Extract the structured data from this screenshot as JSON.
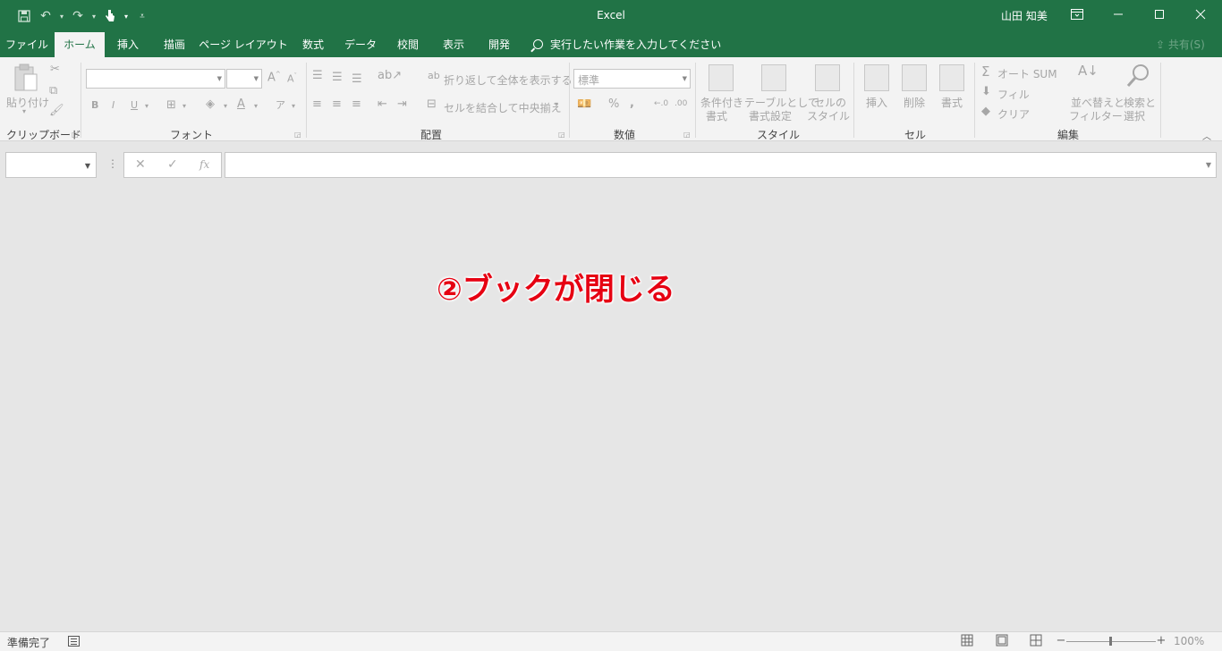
{
  "title_bar": {
    "app_title": "Excel",
    "user_name": "山田 知美"
  },
  "tabs": [
    {
      "label": "ファイル",
      "active": false
    },
    {
      "label": "ホーム",
      "active": true
    },
    {
      "label": "挿入",
      "active": false
    },
    {
      "label": "描画",
      "active": false
    },
    {
      "label": "ページ レイアウト",
      "active": false
    },
    {
      "label": "数式",
      "active": false
    },
    {
      "label": "データ",
      "active": false
    },
    {
      "label": "校閲",
      "active": false
    },
    {
      "label": "表示",
      "active": false
    },
    {
      "label": "開発",
      "active": false
    }
  ],
  "tell_me": "実行したい作業を入力してください",
  "share": "共有(S)",
  "ribbon": {
    "clipboard": {
      "group": "クリップボード",
      "paste": "貼り付け"
    },
    "font": {
      "group": "フォント"
    },
    "alignment": {
      "group": "配置",
      "wrap_text": "折り返して全体を表示する",
      "merge_center": "セルを結合して中央揃え"
    },
    "number": {
      "group": "数値",
      "format": "標準"
    },
    "styles": {
      "group": "スタイル",
      "conditional_1": "条件付き",
      "conditional_2": "書式",
      "table_1": "テーブルとして",
      "table_2": "書式設定",
      "cell_1": "セルの",
      "cell_2": "スタイル"
    },
    "cells": {
      "group": "セル",
      "insert": "挿入",
      "delete": "削除",
      "format": "書式"
    },
    "editing": {
      "group": "編集",
      "autosum": "オート SUM",
      "fill": "フィル",
      "clear": "クリア",
      "sort_1": "並べ替えと",
      "sort_2": "フィルター",
      "find_1": "検索と",
      "find_2": "選択"
    }
  },
  "formula_bar": {
    "cancel_icon": "✕",
    "enter_icon": "✓",
    "fx_label": "fx"
  },
  "annotation": "②ブックが閉じる",
  "status_bar": {
    "status": "準備完了",
    "zoom": "100%"
  },
  "colors": {
    "accent": "#217346",
    "annotation": "#e60012"
  }
}
